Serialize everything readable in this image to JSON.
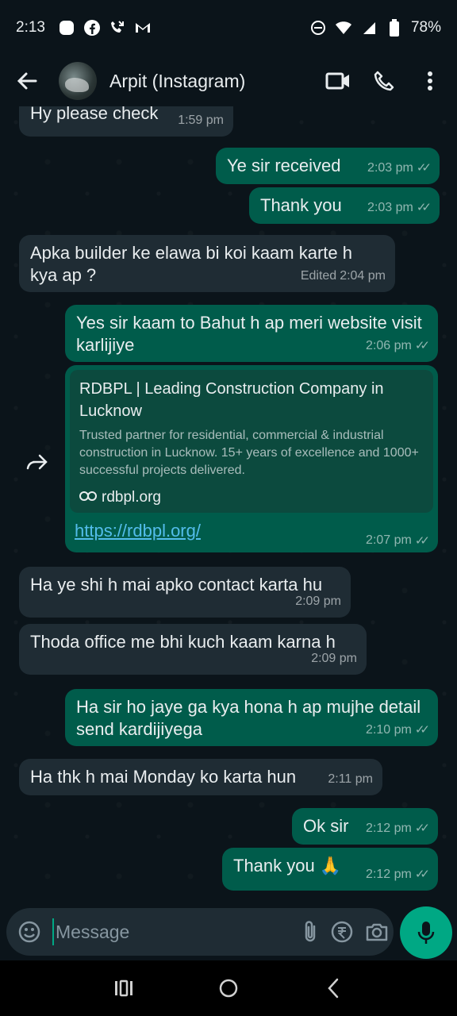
{
  "status_bar": {
    "time": "2:13",
    "battery": "78%"
  },
  "header": {
    "contact_name": "Arpit (Instagram)"
  },
  "messages": [
    {
      "text": "Hy please check",
      "time": "1:59 pm"
    },
    {
      "text": "Ye sir received",
      "time": "2:03 pm"
    },
    {
      "text": "Thank you",
      "time": "2:03 pm"
    },
    {
      "text": "Apka builder ke elawa bi koi kaam karte h kya ap ?",
      "edited": "Edited",
      "time": "2:04 pm"
    },
    {
      "text": "Yes sir kaam to Bahut h ap meri website visit karlijiye",
      "time": "2:06 pm"
    },
    {
      "time": "2:07 pm"
    },
    {
      "text": "Ha ye shi h mai apko contact karta hu",
      "time": "2:09 pm"
    },
    {
      "text": "Thoda office me bhi kuch kaam karna h",
      "time": "2:09 pm"
    },
    {
      "text": "Ha sir ho jaye ga kya hona h ap mujhe detail send kardijiyega",
      "time": "2:10 pm"
    },
    {
      "text": "Ha thk h mai Monday ko karta hun",
      "time": "2:11 pm"
    },
    {
      "text": "Ok sir",
      "time": "2:12 pm"
    },
    {
      "text": "Thank you 🙏",
      "time": "2:12 pm"
    }
  ],
  "link_preview": {
    "title": "RDBPL | Leading Construction Company in Lucknow",
    "description": "Trusted partner for residential, commercial & industrial construction in Lucknow. 15+ years of excellence and 1000+ successful projects delivered.",
    "domain": "rdbpl.org",
    "url": "https://rdbpl.org/"
  },
  "composer": {
    "placeholder": "Message"
  },
  "colors": {
    "incoming": "#1f2c34",
    "outgoing": "#005c4b",
    "accent": "#00a884",
    "link": "#53bdeb"
  }
}
